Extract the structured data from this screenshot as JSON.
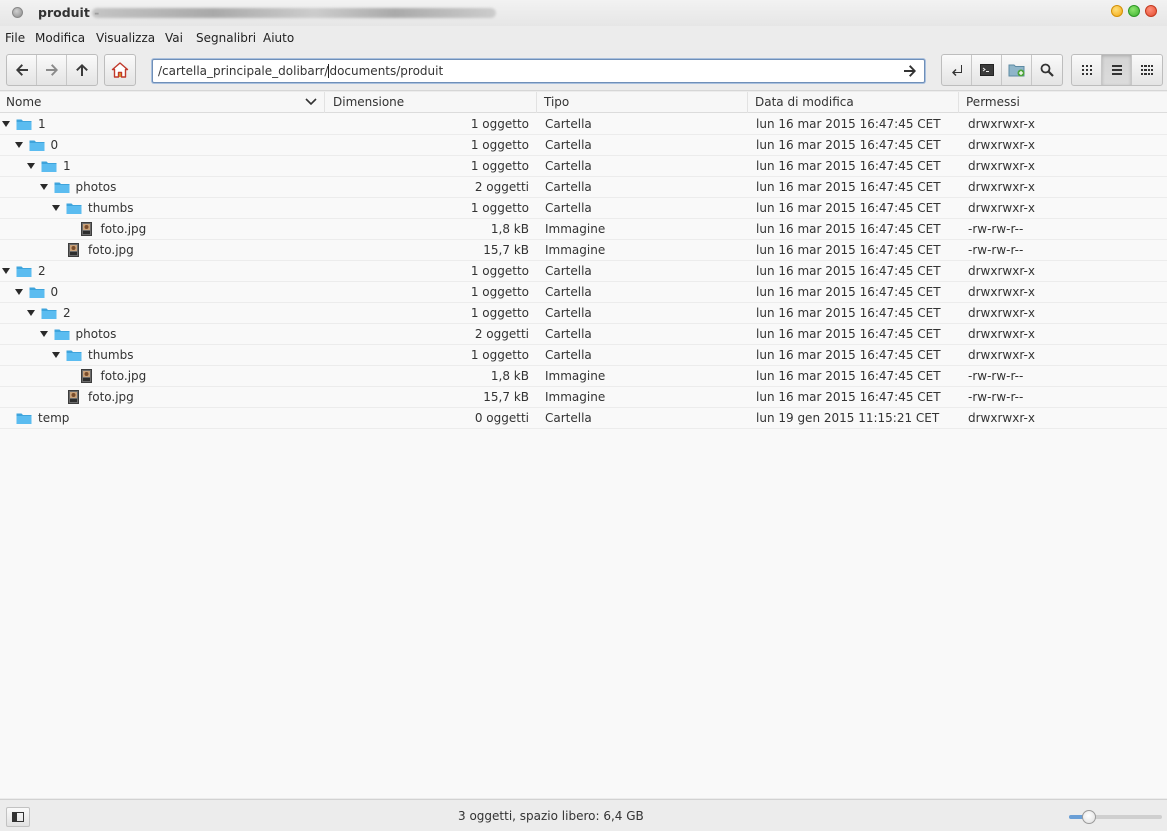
{
  "window": {
    "title": "produit - "
  },
  "menu": [
    "File",
    "Modifica",
    "Visualizza",
    "Vai",
    "Segnalibri",
    "Aiuto"
  ],
  "toolbar": {
    "nav_icons": [
      "back-icon",
      "forward-icon",
      "up-icon"
    ],
    "home_icon": "home-icon",
    "tool_icons": [
      "terminal-return-icon",
      "terminal-icon",
      "new-folder-icon",
      "search-icon"
    ],
    "view_icons": [
      "icon-view-icon",
      "list-view-icon",
      "compact-view-icon"
    ],
    "active_view": "list-view-icon"
  },
  "location": {
    "path_before_caret": "/cartella_principale_dolibarr/",
    "path_after_caret": "documents/produit"
  },
  "columns": {
    "name": "Nome",
    "size": "Dimensione",
    "type": "Tipo",
    "date": "Data di modifica",
    "perm": "Permessi"
  },
  "files": [
    {
      "name": "1",
      "level": 0,
      "kind": "folder",
      "expanded": true,
      "size": "1 oggetto",
      "type": "Cartella",
      "date": "lun 16 mar 2015 16:47:45 CET",
      "perm": "drwxrwxr-x"
    },
    {
      "name": "0",
      "level": 1,
      "kind": "folder",
      "expanded": true,
      "size": "1 oggetto",
      "type": "Cartella",
      "date": "lun 16 mar 2015 16:47:45 CET",
      "perm": "drwxrwxr-x"
    },
    {
      "name": "1",
      "level": 2,
      "kind": "folder",
      "expanded": true,
      "size": "1 oggetto",
      "type": "Cartella",
      "date": "lun 16 mar 2015 16:47:45 CET",
      "perm": "drwxrwxr-x"
    },
    {
      "name": "photos",
      "level": 3,
      "kind": "folder",
      "expanded": true,
      "size": "2 oggetti",
      "type": "Cartella",
      "date": "lun 16 mar 2015 16:47:45 CET",
      "perm": "drwxrwxr-x"
    },
    {
      "name": "thumbs",
      "level": 4,
      "kind": "folder",
      "expanded": true,
      "size": "1 oggetto",
      "type": "Cartella",
      "date": "lun 16 mar 2015 16:47:45 CET",
      "perm": "drwxrwxr-x"
    },
    {
      "name": "foto.jpg",
      "level": 5,
      "kind": "image",
      "expanded": false,
      "size": "1,8 kB",
      "type": "Immagine",
      "date": "lun 16 mar 2015 16:47:45 CET",
      "perm": "-rw-rw-r--"
    },
    {
      "name": "foto.jpg",
      "level": 4,
      "kind": "image",
      "expanded": false,
      "size": "15,7 kB",
      "type": "Immagine",
      "date": "lun 16 mar 2015 16:47:45 CET",
      "perm": "-rw-rw-r--"
    },
    {
      "name": "2",
      "level": 0,
      "kind": "folder",
      "expanded": true,
      "size": "1 oggetto",
      "type": "Cartella",
      "date": "lun 16 mar 2015 16:47:45 CET",
      "perm": "drwxrwxr-x"
    },
    {
      "name": "0",
      "level": 1,
      "kind": "folder",
      "expanded": true,
      "size": "1 oggetto",
      "type": "Cartella",
      "date": "lun 16 mar 2015 16:47:45 CET",
      "perm": "drwxrwxr-x"
    },
    {
      "name": "2",
      "level": 2,
      "kind": "folder",
      "expanded": true,
      "size": "1 oggetto",
      "type": "Cartella",
      "date": "lun 16 mar 2015 16:47:45 CET",
      "perm": "drwxrwxr-x"
    },
    {
      "name": "photos",
      "level": 3,
      "kind": "folder",
      "expanded": true,
      "size": "2 oggetti",
      "type": "Cartella",
      "date": "lun 16 mar 2015 16:47:45 CET",
      "perm": "drwxrwxr-x"
    },
    {
      "name": "thumbs",
      "level": 4,
      "kind": "folder",
      "expanded": true,
      "size": "1 oggetto",
      "type": "Cartella",
      "date": "lun 16 mar 2015 16:47:45 CET",
      "perm": "drwxrwxr-x"
    },
    {
      "name": "foto.jpg",
      "level": 5,
      "kind": "image",
      "expanded": false,
      "size": "1,8 kB",
      "type": "Immagine",
      "date": "lun 16 mar 2015 16:47:45 CET",
      "perm": "-rw-rw-r--"
    },
    {
      "name": "foto.jpg",
      "level": 4,
      "kind": "image",
      "expanded": false,
      "size": "15,7 kB",
      "type": "Immagine",
      "date": "lun 16 mar 2015 16:47:45 CET",
      "perm": "-rw-rw-r--"
    },
    {
      "name": "temp",
      "level": 0,
      "kind": "folder",
      "expanded": false,
      "size": "0 oggetti",
      "type": "Cartella",
      "date": "lun 19 gen 2015 11:15:21 CET",
      "perm": "drwxrwxr-x"
    }
  ],
  "status": {
    "text": "3 oggetti, spazio libero: 6,4 GB",
    "sidebar_toggle_icon": "sidebar-toggle-icon",
    "zoom_fraction": 0.22
  },
  "colors": {
    "folder": "#5bbcf0",
    "folder_dark": "#3ea4dc",
    "accent": "#6a9fd6"
  }
}
